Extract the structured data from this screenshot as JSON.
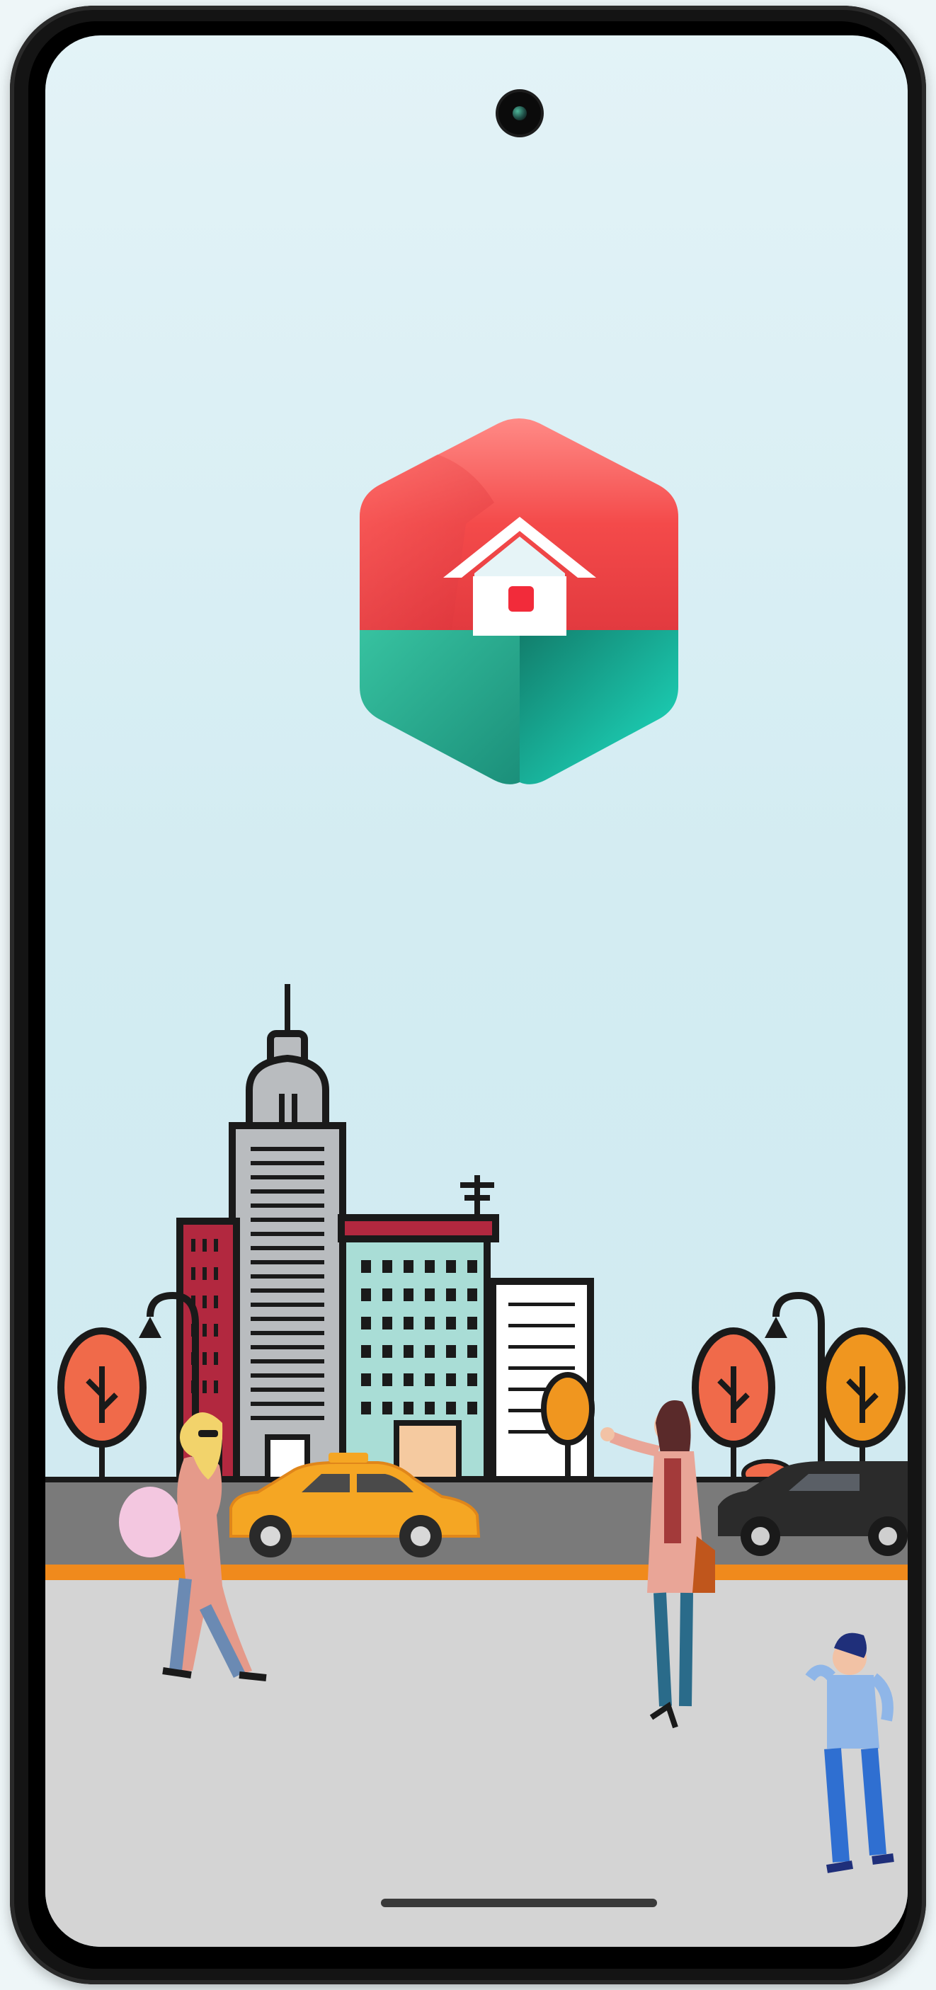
{
  "screen": {
    "name": "splash-screen",
    "background_top": "#e3f3f7",
    "background_bottom": "#cfe9f0"
  },
  "logo": {
    "icon": "house-hexagon-logo",
    "color_top": "#f24a4a",
    "color_bottom": "#19c3a8"
  },
  "illustration": {
    "icon": "city-street-illustration",
    "road_color": "#7a7a7a",
    "accent_line_color": "#f08a1c",
    "sidewalk_color": "#d4d4d4"
  },
  "system": {
    "home_indicator": "home-indicator",
    "camera": "front-camera-icon"
  }
}
